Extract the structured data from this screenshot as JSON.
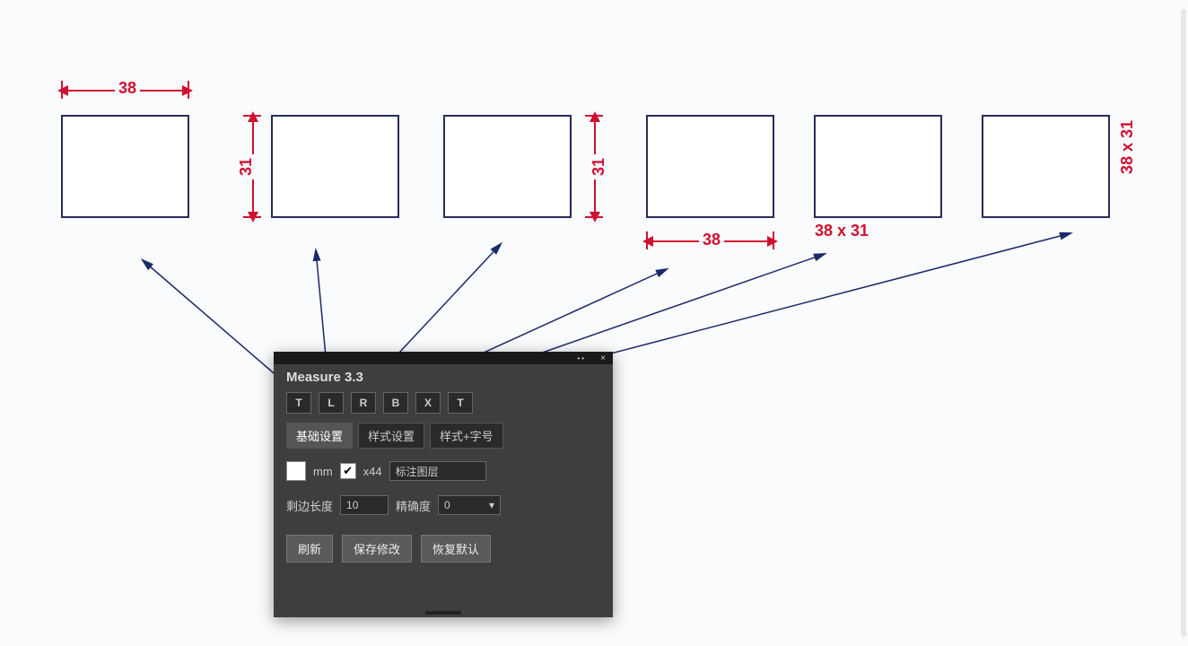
{
  "dimensions": {
    "width_top": "38",
    "height_left": "31",
    "height_right": "31",
    "width_bottom": "38",
    "size_below": "38 x 31",
    "size_side": "38 x 31"
  },
  "panel": {
    "title": "Measure 3.3",
    "mode_buttons": [
      "T",
      "L",
      "R",
      "B",
      "X",
      "T"
    ],
    "tabs": {
      "basic": "基础设置",
      "style": "样式设置",
      "symbol": "样式+字号"
    },
    "units_label": "mm",
    "checkbox_label": "x44",
    "layer_label": "标注图层",
    "side_length_label": "剩边长度",
    "side_length_value": "10",
    "precision_label": "精确度",
    "precision_value": "0",
    "actions": {
      "refresh": "刷新",
      "save": "保存修改",
      "reset": "恢复默认"
    }
  }
}
